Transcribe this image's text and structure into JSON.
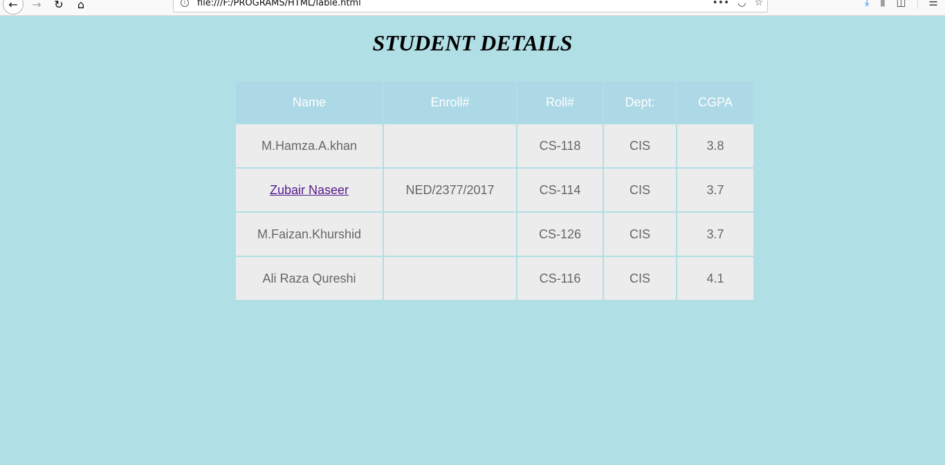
{
  "browser": {
    "url": "file:///F:/PROGRAMS/HTML/lable.html",
    "icons": {
      "back": "back-arrow-icon",
      "forward": "forward-arrow-icon",
      "reload": "reload-icon",
      "home": "home-icon",
      "info": "info-icon",
      "more": "more-icon",
      "pocket": "pocket-icon",
      "bookmark": "star-icon",
      "download": "download-icon",
      "library": "library-icon",
      "sidebar": "sidebar-icon",
      "menu": "hamburger-menu-icon"
    }
  },
  "page": {
    "title": "STUDENT DETAILS",
    "background_color": "#b0dfe5"
  },
  "table": {
    "header_color": "#add8e6",
    "cell_color": "#ececec",
    "headers": [
      "Name",
      "Enroll#",
      "Roll#",
      "Dept:",
      "CGPA"
    ],
    "rows": [
      {
        "name": "M.Hamza.A.khan",
        "name_is_link": false,
        "enroll": "",
        "roll": "CS-118",
        "dept": "CIS",
        "cgpa": "3.8"
      },
      {
        "name": "Zubair Naseer",
        "name_is_link": true,
        "enroll": "NED/2377/2017",
        "roll": "CS-114",
        "dept": "CIS",
        "cgpa": "3.7"
      },
      {
        "name": "M.Faizan.Khurshid",
        "name_is_link": false,
        "enroll": "",
        "roll": "CS-126",
        "dept": "CIS",
        "cgpa": "3.7"
      },
      {
        "name": "Ali Raza Qureshi",
        "name_is_link": false,
        "enroll": "",
        "roll": "CS-116",
        "dept": "CIS",
        "cgpa": "4.1"
      }
    ]
  }
}
